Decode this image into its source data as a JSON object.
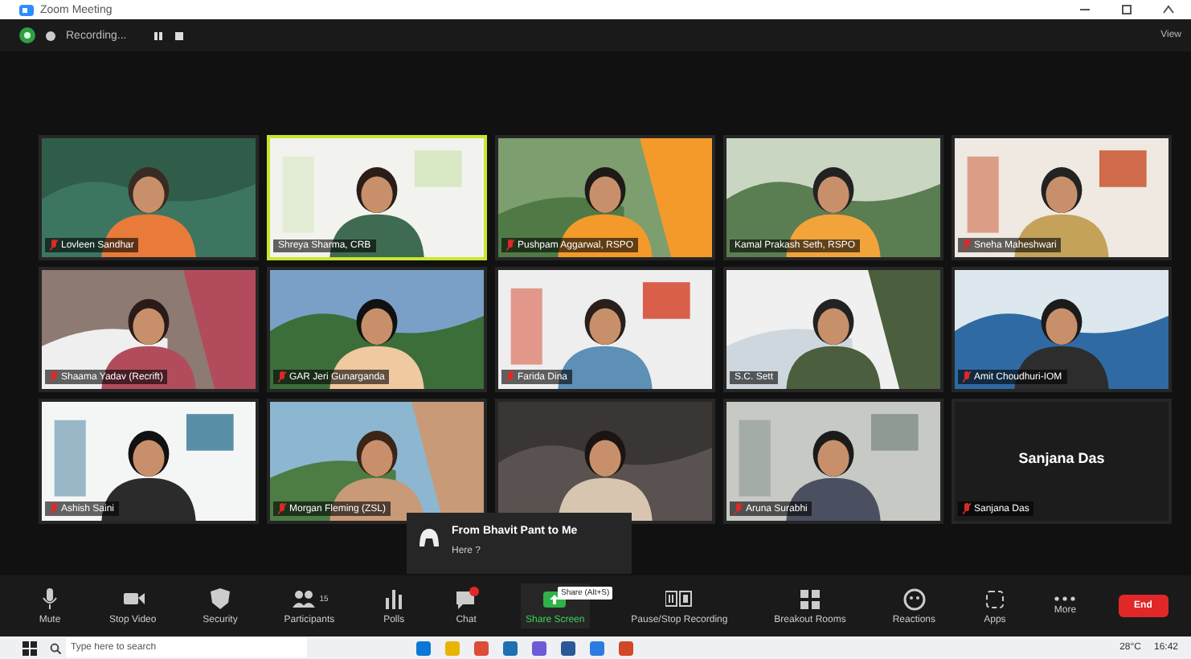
{
  "window": {
    "title": "Zoom Meeting"
  },
  "meeting_bar": {
    "recording_label": "Recording...",
    "view_label": "View"
  },
  "participants": [
    {
      "name": "Lovleen Sandhar",
      "kind": "video",
      "active_speaker": false,
      "muted": true
    },
    {
      "name": "Shreya Sharma, CRB",
      "kind": "video",
      "active_speaker": true,
      "muted": false
    },
    {
      "name": "Pushpam Aggarwal, RSPO",
      "kind": "video",
      "active_speaker": false,
      "muted": true
    },
    {
      "name": "Kamal Prakash Seth, RSPO",
      "kind": "video",
      "active_speaker": false,
      "muted": false
    },
    {
      "name": "Sneha Maheshwari",
      "kind": "video",
      "active_speaker": false,
      "muted": true
    },
    {
      "name": "Shaama Yadav (Recrift)",
      "kind": "video",
      "active_speaker": false,
      "muted": true
    },
    {
      "name": "GAR Jeri Gunarganda",
      "kind": "video",
      "active_speaker": false,
      "muted": true
    },
    {
      "name": "Farida Dina",
      "kind": "video",
      "active_speaker": false,
      "muted": true
    },
    {
      "name": "S.C. Sett",
      "kind": "video",
      "active_speaker": false,
      "muted": false
    },
    {
      "name": "Amit Choudhuri-IOM",
      "kind": "video",
      "active_speaker": false,
      "muted": true
    },
    {
      "name": "Ashish Saini",
      "kind": "video",
      "active_speaker": false,
      "muted": true
    },
    {
      "name": "Morgan Fleming (ZSL)",
      "kind": "video",
      "active_speaker": false,
      "muted": true
    },
    {
      "kind": "video",
      "active_speaker": false
    },
    {
      "name": "Aruna Surabhi",
      "kind": "video",
      "active_speaker": false,
      "muted": true
    },
    {
      "name": "Sanjana Das",
      "display_name": "Sanjana Das",
      "kind": "name_only",
      "active_speaker": false,
      "muted": true
    }
  ],
  "chat_notification": {
    "sender": "From Bhavit Pant to Me",
    "message": "Here ?"
  },
  "toolbar": [
    {
      "kind": "mic",
      "label": "Mute"
    },
    {
      "kind": "video",
      "label": "Stop Video"
    },
    {
      "kind": "security",
      "label": "Security"
    },
    {
      "kind": "participants",
      "label": "Participants",
      "count": "15"
    },
    {
      "kind": "polls",
      "label": "Polls"
    },
    {
      "kind": "chat",
      "label": "Chat"
    },
    {
      "kind": "share",
      "label": "Share Screen",
      "tooltip": "Share (Alt+S)"
    },
    {
      "kind": "recording",
      "label": "Pause/Stop Recording"
    },
    {
      "kind": "breakout",
      "label": "Breakout Rooms"
    },
    {
      "kind": "reactions",
      "label": "Reactions"
    },
    {
      "kind": "apps",
      "label": "Apps"
    },
    {
      "kind": "more",
      "label": "More"
    },
    {
      "kind": "end",
      "label": "End"
    }
  ],
  "taskbar": {
    "search_placeholder": "Type here to search",
    "weather": "28°C",
    "time": "16:42"
  }
}
